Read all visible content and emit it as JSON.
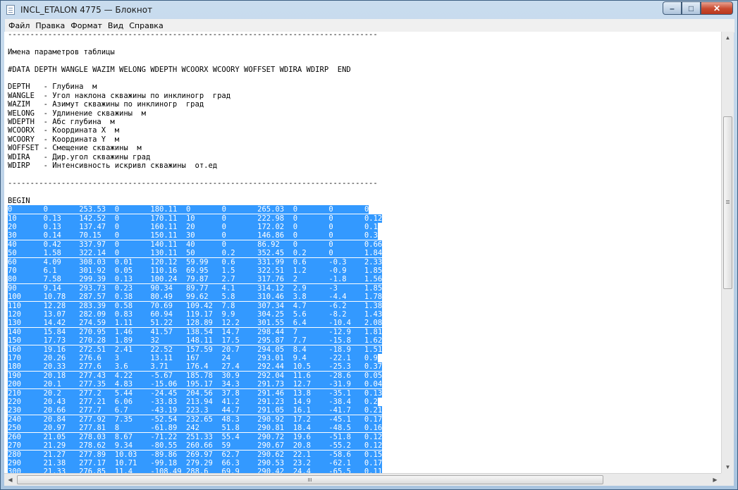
{
  "window": {
    "title": "INCL_ETALON 4775 — Блокнот",
    "buttons": {
      "minimize": "–",
      "maximize": "□",
      "close": "✕"
    }
  },
  "menu": [
    "Файл",
    "Правка",
    "Формат",
    "Вид",
    "Справка"
  ],
  "document": {
    "lines": [
      "-----------------------------------------------------------------------------------",
      "",
      "Имена параметров таблицы",
      "",
      "#DATA DEPTH WANGLE WAZIM WELONG WDEPTH WCOORX WCOORY WOFFSET WDIRA WDIRP  END",
      "",
      "DEPTH   - Глубина  м",
      "WANGLE  - Угол наклона скважины по инклиногр  град",
      "WAZIM   - Азимут скважины по инклиногр  град",
      "WELONG  - Удлинение скважины  м",
      "WDEPTH  - Абс глубина  м",
      "WCOORX  - Координата X  м",
      "WCOORY  - Координата Y  м",
      "WOFFSET - Смещение скважины  м",
      "WDIRA   - Дир.угол скважины град",
      "WDIRP   - Интенсивность искривл скважины  от.ед",
      "",
      "-----------------------------------------------------------------------------------",
      "",
      "BEGIN"
    ],
    "table_rows": [
      [
        "0",
        "0",
        "253.53",
        "0",
        "180.11",
        "0",
        "0",
        "265.03",
        "0",
        "0",
        "0"
      ],
      [
        "10",
        "0.13",
        "142.52",
        "0",
        "170.11",
        "10",
        "0",
        "222.98",
        "0",
        "0",
        "0.12"
      ],
      [
        "20",
        "0.13",
        "137.47",
        "0",
        "160.11",
        "20",
        "0",
        "172.02",
        "0",
        "0",
        "0.1"
      ],
      [
        "30",
        "0.14",
        "70.15",
        "0",
        "150.11",
        "30",
        "0",
        "146.86",
        "0",
        "0",
        "0.3"
      ],
      [
        "40",
        "0.42",
        "337.97",
        "0",
        "140.11",
        "40",
        "0",
        "86.92",
        "0",
        "0",
        "0.66"
      ],
      [
        "50",
        "1.58",
        "322.14",
        "0",
        "130.11",
        "50",
        "0.2",
        "352.45",
        "0.2",
        "0",
        "1.84"
      ],
      [
        "60",
        "4.09",
        "308.03",
        "0.01",
        "120.12",
        "59.99",
        "0.6",
        "331.99",
        "0.6",
        "-0.3",
        "2.33"
      ],
      [
        "70",
        "6.1",
        "301.92",
        "0.05",
        "110.16",
        "69.95",
        "1.5",
        "322.51",
        "1.2",
        "-0.9",
        "1.85"
      ],
      [
        "80",
        "7.58",
        "299.39",
        "0.13",
        "100.24",
        "79.87",
        "2.7",
        "317.76",
        "2",
        "-1.8",
        "1.56"
      ],
      [
        "90",
        "9.14",
        "293.73",
        "0.23",
        "90.34",
        "89.77",
        "4.1",
        "314.12",
        "2.9",
        "-3",
        "1.85"
      ],
      [
        "100",
        "10.78",
        "287.57",
        "0.38",
        "80.49",
        "99.62",
        "5.8",
        "310.46",
        "3.8",
        "-4.4",
        "1.78"
      ],
      [
        "110",
        "12.28",
        "283.39",
        "0.58",
        "70.69",
        "109.42",
        "7.8",
        "307.34",
        "4.7",
        "-6.2",
        "1.38"
      ],
      [
        "120",
        "13.07",
        "282.09",
        "0.83",
        "60.94",
        "119.17",
        "9.9",
        "304.25",
        "5.6",
        "-8.2",
        "1.43"
      ],
      [
        "130",
        "14.42",
        "274.59",
        "1.11",
        "51.22",
        "128.89",
        "12.2",
        "301.55",
        "6.4",
        "-10.4",
        "2.08"
      ],
      [
        "140",
        "15.84",
        "270.95",
        "1.46",
        "41.57",
        "138.54",
        "14.7",
        "298.44",
        "7",
        "-12.9",
        "1.81"
      ],
      [
        "150",
        "17.73",
        "270.28",
        "1.89",
        "32",
        "148.11",
        "17.5",
        "295.87",
        "7.7",
        "-15.8",
        "1.62"
      ],
      [
        "160",
        "19.16",
        "272.51",
        "2.41",
        "22.52",
        "157.59",
        "20.7",
        "294.05",
        "8.4",
        "-18.9",
        "1.51"
      ],
      [
        "170",
        "20.26",
        "276.6",
        "3",
        "13.11",
        "167",
        "24",
        "293.01",
        "9.4",
        "-22.1",
        "0.9"
      ],
      [
        "180",
        "20.33",
        "277.6",
        "3.6",
        "3.71",
        "176.4",
        "27.4",
        "292.44",
        "10.5",
        "-25.3",
        "0.37"
      ],
      [
        "190",
        "20.18",
        "277.43",
        "4.22",
        "-5.67",
        "185.78",
        "30.9",
        "292.04",
        "11.6",
        "-28.6",
        "0.05"
      ],
      [
        "200",
        "20.1",
        "277.35",
        "4.83",
        "-15.06",
        "195.17",
        "34.3",
        "291.73",
        "12.7",
        "-31.9",
        "0.04"
      ],
      [
        "210",
        "20.2",
        "277.2",
        "5.44",
        "-24.45",
        "204.56",
        "37.8",
        "291.46",
        "13.8",
        "-35.1",
        "0.13"
      ],
      [
        "220",
        "20.43",
        "277.21",
        "6.06",
        "-33.83",
        "213.94",
        "41.2",
        "291.23",
        "14.9",
        "-38.4",
        "0.2"
      ],
      [
        "230",
        "20.66",
        "277.7",
        "6.7",
        "-43.19",
        "223.3",
        "44.7",
        "291.05",
        "16.1",
        "-41.7",
        "0.21"
      ],
      [
        "240",
        "20.84",
        "277.92",
        "7.35",
        "-52.54",
        "232.65",
        "48.3",
        "290.92",
        "17.2",
        "-45.1",
        "0.17"
      ],
      [
        "250",
        "20.97",
        "277.81",
        "8",
        "-61.89",
        "242",
        "51.8",
        "290.81",
        "18.4",
        "-48.5",
        "0.16"
      ],
      [
        "260",
        "21.05",
        "278.03",
        "8.67",
        "-71.22",
        "251.33",
        "55.4",
        "290.72",
        "19.6",
        "-51.8",
        "0.12"
      ],
      [
        "270",
        "21.29",
        "278.62",
        "9.34",
        "-80.55",
        "260.66",
        "59",
        "290.67",
        "20.8",
        "-55.2",
        "0.12"
      ],
      [
        "280",
        "21.27",
        "277.89",
        "10.03",
        "-89.86",
        "269.97",
        "62.7",
        "290.62",
        "22.1",
        "-58.6",
        "0.15"
      ],
      [
        "290",
        "21.38",
        "277.17",
        "10.71",
        "-99.18",
        "279.29",
        "66.3",
        "290.53",
        "23.2",
        "-62.1",
        "0.17"
      ],
      [
        "300",
        "21.33",
        "276.85",
        "11.4",
        "-108.49",
        "288.6",
        "69.9",
        "290.42",
        "24.4",
        "-65.5",
        "0.11"
      ]
    ]
  },
  "icons": {
    "app": "notepad-icon",
    "scroll_up": "arrow-up-icon",
    "scroll_down": "arrow-down-icon",
    "scroll_left": "arrow-left-icon",
    "scroll_right": "arrow-right-icon"
  },
  "colors": {
    "selection": "#3399ff",
    "close_button": "#c94a2f"
  }
}
